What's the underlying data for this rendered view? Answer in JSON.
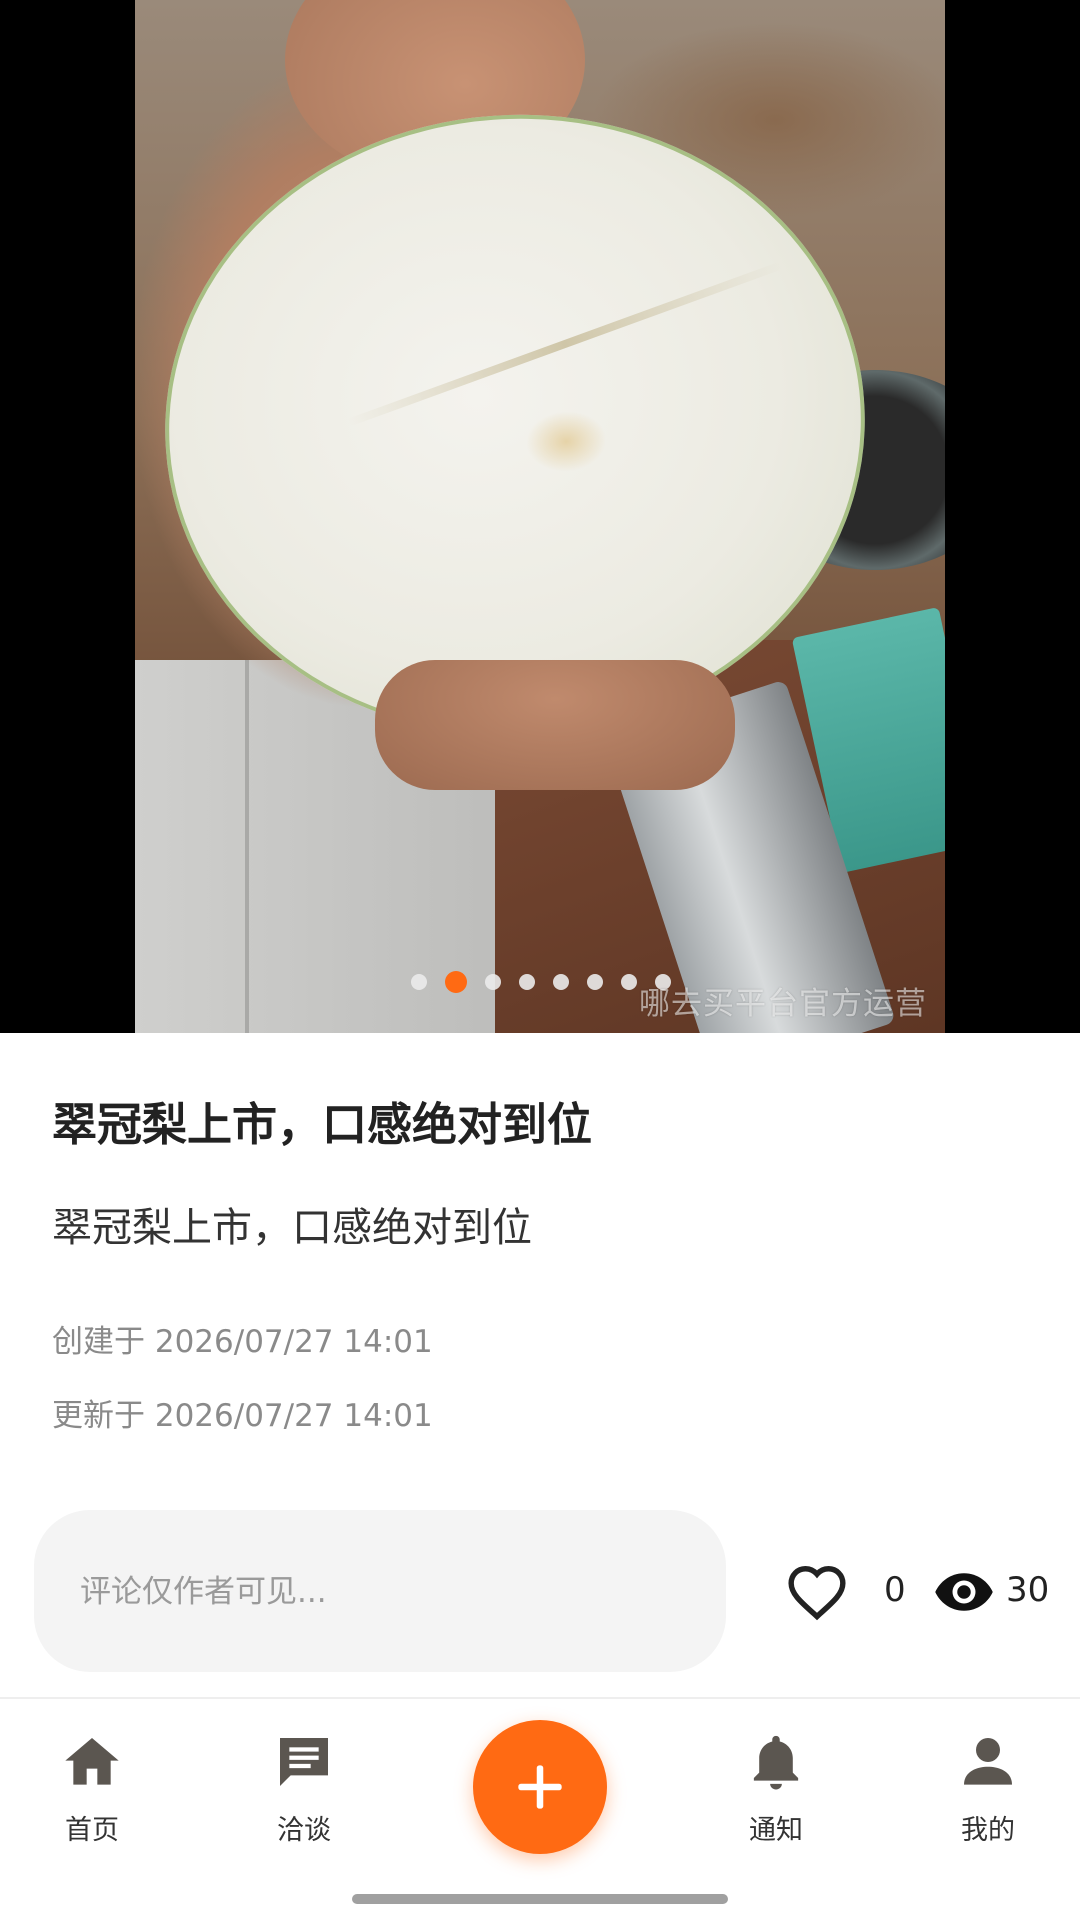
{
  "post": {
    "title": "翠冠梨上市，口感绝对到位",
    "description": "翠冠梨上市，口感绝对到位",
    "created": "创建于 2026/07/27 14:01",
    "updated": "更新于 2026/07/27 14:01"
  },
  "carousel": {
    "watermark": "哪去买平台官方运营",
    "total_images": 8,
    "current_index": 2
  },
  "comment": {
    "placeholder": "评论仅作者可见..."
  },
  "stats": {
    "likes": "0",
    "views": "30"
  },
  "bottom_nav": {
    "items": [
      {
        "label": "首页",
        "icon": "home-icon"
      },
      {
        "label": "洽谈",
        "icon": "chat-icon"
      },
      {
        "label": "通知",
        "icon": "bell-icon"
      },
      {
        "label": "我的",
        "icon": "user-icon"
      }
    ],
    "fab_icon": "plus-icon"
  },
  "colors": {
    "accent": "#ff6a13",
    "nav_icon": "#5b5650"
  }
}
